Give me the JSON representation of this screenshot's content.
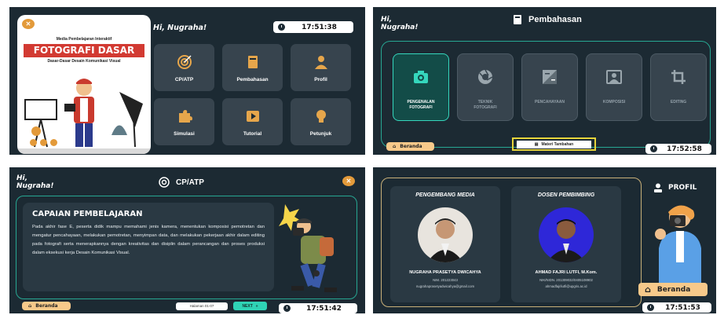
{
  "panel1": {
    "greeting": "Hi, Nugraha!",
    "clock": "17:51:38",
    "hero": {
      "subtitle": "Media Pembelajaran Interaktif",
      "title": "FOTOGRAFI DASAR",
      "tagline": "Dasar-Dasar Desain Komunikasi Visual"
    },
    "menu": [
      {
        "label": "CP/ATP",
        "icon": "target-icon"
      },
      {
        "label": "Pembahasan",
        "icon": "book-icon"
      },
      {
        "label": "Profil",
        "icon": "user-icon"
      },
      {
        "label": "Simulasi",
        "icon": "puzzle-icon"
      },
      {
        "label": "Tutorial",
        "icon": "play-icon"
      },
      {
        "label": "Petunjuk",
        "icon": "lightbulb-icon"
      }
    ]
  },
  "panel2": {
    "greeting_line1": "Hi,",
    "greeting_line2": "Nugraha!",
    "title": "Pembahasan",
    "tiles": [
      {
        "line1": "PENGENALAN",
        "line2": "FOTOGRAFI",
        "active": true
      },
      {
        "line1": "TEKNIK",
        "line2": "FOTOGRAFI",
        "active": false
      },
      {
        "line1": "PENCAHAYAAN",
        "line2": "",
        "active": false
      },
      {
        "line1": "KOMPOSISI",
        "line2": "",
        "active": false
      },
      {
        "line1": "EDITING",
        "line2": "",
        "active": false
      }
    ],
    "beranda": "Beranda",
    "materi": "Materi Tambahan",
    "clock": "17:52:58"
  },
  "panel3": {
    "greeting_line1": "Hi,",
    "greeting_line2": "Nugraha!",
    "title": "CP/ATP",
    "card_title": "CAPAIAN PEMBELAJARAN",
    "card_text": "Pada akhir fase E, peserta didik mampu memahami jenis kamera, menentukan komposisi pemotretan dan mengatur pencahayaan, melakukan pemotretan, menyimpan data, dan melakukan pekerjaan akhir dalam editing pada fotografi serta menerapkannya dengan kreativitas dan disiplin dalam perancangan dan proses produksi dalam eksekusi kerja Desain Komunikasi Visual.",
    "beranda": "Beranda",
    "pages": "Halaman 01-07",
    "next": "NEXT",
    "clock": "17:51:42"
  },
  "panel4": {
    "title": "PROFIL",
    "dev": {
      "heading": "PENGEMBANG MEDIA",
      "name": "NUGRAHA PRASETYA DWICAHYA",
      "id": "NIM. 201223043",
      "email": "nugrahaprasetyadwicahya@gmail.com"
    },
    "lecturer": {
      "heading": "DOSEN PEMBIMBING",
      "name": "AHMAD FAJRI LUTFI, M.Kom.",
      "id": "NIK/NIDN. 201309032/0405108902",
      "email": "ahmadfajrilutfi@upgris.ac.id"
    },
    "beranda": "Beranda",
    "clock": "17:51:53"
  }
}
